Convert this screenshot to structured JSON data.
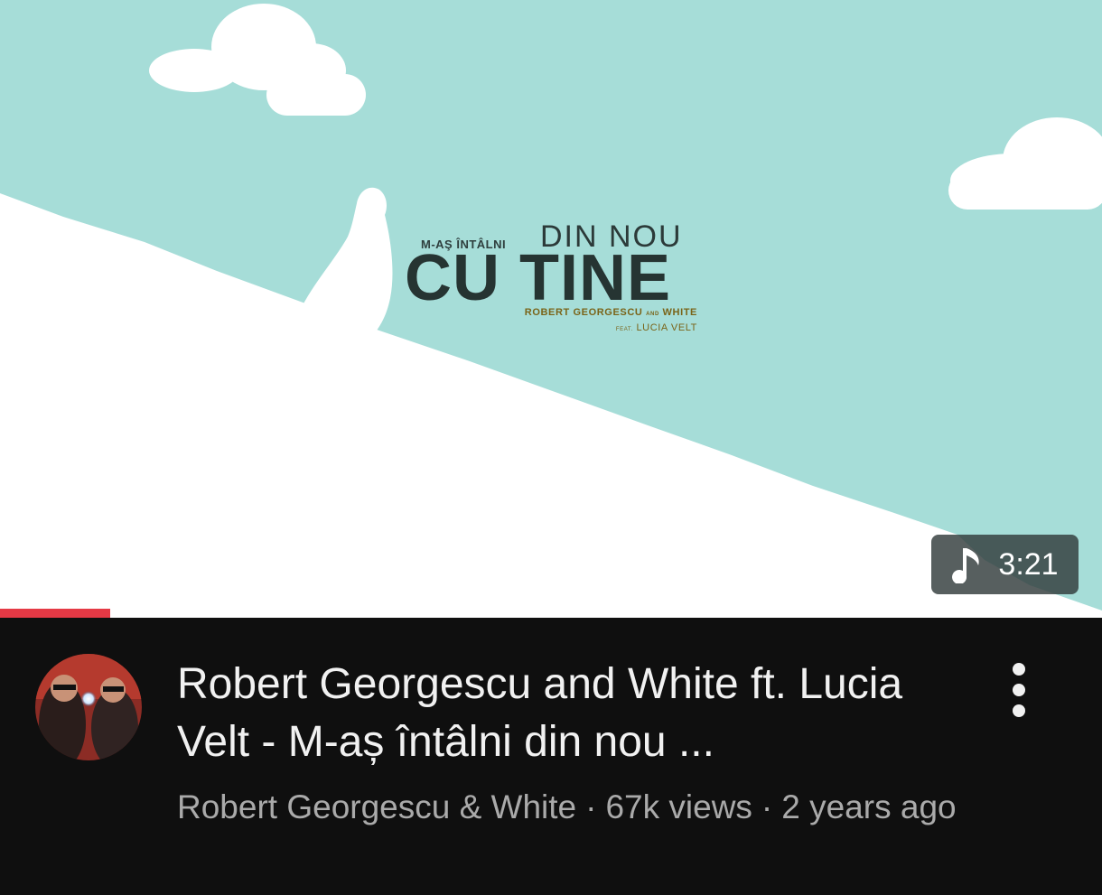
{
  "video": {
    "thumbnail": {
      "art_small_line": "M-AŞ ÎNTÂLNI",
      "art_din_nou": "DIN NOU",
      "art_cu_tine": "CU TINE",
      "art_artist_1": "ROBERT GEORGESCU",
      "art_and": "AND",
      "art_artist_2": "WHITE",
      "art_feat": "FEAT.",
      "art_featured": "LUCIA VELT",
      "sky_color": "#a6ddd8"
    },
    "duration": "3:21",
    "duration_icon": "music-note-icon",
    "watch_progress": 0.1,
    "progress_color": "#e53945",
    "title": "Robert Georgescu and White ft. Lucia Velt  - M-aș întâlni din nou ...",
    "channel": "Robert Georgescu & White",
    "views": "67k views",
    "age": "2 years ago",
    "separator": "·",
    "more_icon": "more-vert-icon"
  }
}
